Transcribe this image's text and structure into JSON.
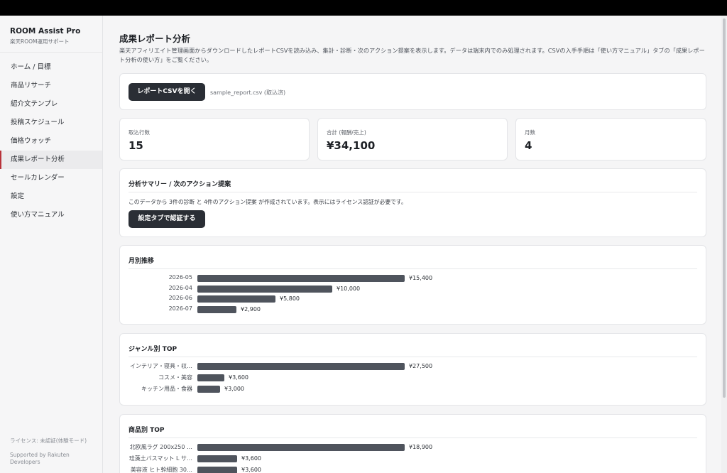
{
  "app": {
    "name": "ROOM Assist Pro",
    "subtitle": "楽天ROOM運用サポート"
  },
  "sidebar": {
    "items": [
      {
        "label": "ホーム / 目標",
        "active": false
      },
      {
        "label": "商品リサーチ",
        "active": false
      },
      {
        "label": "紹介文テンプレ",
        "active": false
      },
      {
        "label": "投稿スケジュール",
        "active": false
      },
      {
        "label": "価格ウォッチ",
        "active": false
      },
      {
        "label": "成果レポート分析",
        "active": true
      },
      {
        "label": "セールカレンダー",
        "active": false
      },
      {
        "label": "設定",
        "active": false
      },
      {
        "label": "使い方マニュアル",
        "active": false
      }
    ],
    "license": "ライセンス: 未認証(体験モード)",
    "supported": "Supported by Rakuten Developers"
  },
  "page": {
    "title": "成果レポート分析",
    "description": "楽天アフィリエイト管理画面からダウンロードしたレポートCSVを読み込み、集計・診断・次のアクション提案を表示します。データは端末内でのみ処理されます。CSVの入手手順は「使い方マニュアル」タブの「成果レポート分析の使い方」をご覧ください。"
  },
  "upload": {
    "button_label": "レポートCSVを開く",
    "file_status": "sample_report.csv (取込済)"
  },
  "stats": [
    {
      "label": "取込行数",
      "value": "15"
    },
    {
      "label": "合計 (報酬/売上)",
      "value": "¥34,100"
    },
    {
      "label": "月数",
      "value": "4"
    }
  ],
  "summary": {
    "title": "分析サマリー / 次のアクション提案",
    "text": "このデータから 3件の診断 と 4件のアクション提案 が作成されています。表示にはライセンス認証が必要です。",
    "auth_button": "設定タブで認証する"
  },
  "colors": {
    "accent": "#b8323a",
    "bar": "#4f545d",
    "button": "#2a2e35"
  },
  "chart_data": [
    {
      "type": "bar",
      "title": "月別推移",
      "categories": [
        "2026-05",
        "2026-04",
        "2026-06",
        "2026-07"
      ],
      "values": [
        15400,
        10000,
        5800,
        2900
      ],
      "labels": [
        "¥15,400",
        "¥10,000",
        "¥5,800",
        "¥2,900"
      ]
    },
    {
      "type": "bar",
      "title": "ジャンル別 TOP",
      "categories": [
        "インテリア・寝具・収…",
        "コスメ・美容",
        "キッチン用品・食器"
      ],
      "values": [
        27500,
        3600,
        3000
      ],
      "labels": [
        "¥27,500",
        "¥3,600",
        "¥3,000"
      ]
    },
    {
      "type": "bar",
      "title": "商品別 TOP",
      "categories": [
        "北欧風ラグ 200x250 …",
        "珪藻土バスマット L サ…",
        "美容液 ヒト幹細胞 30…"
      ],
      "values": [
        18900,
        3600,
        3600
      ],
      "labels": [
        "¥18,900",
        "¥3,600",
        "¥3,600"
      ]
    }
  ]
}
